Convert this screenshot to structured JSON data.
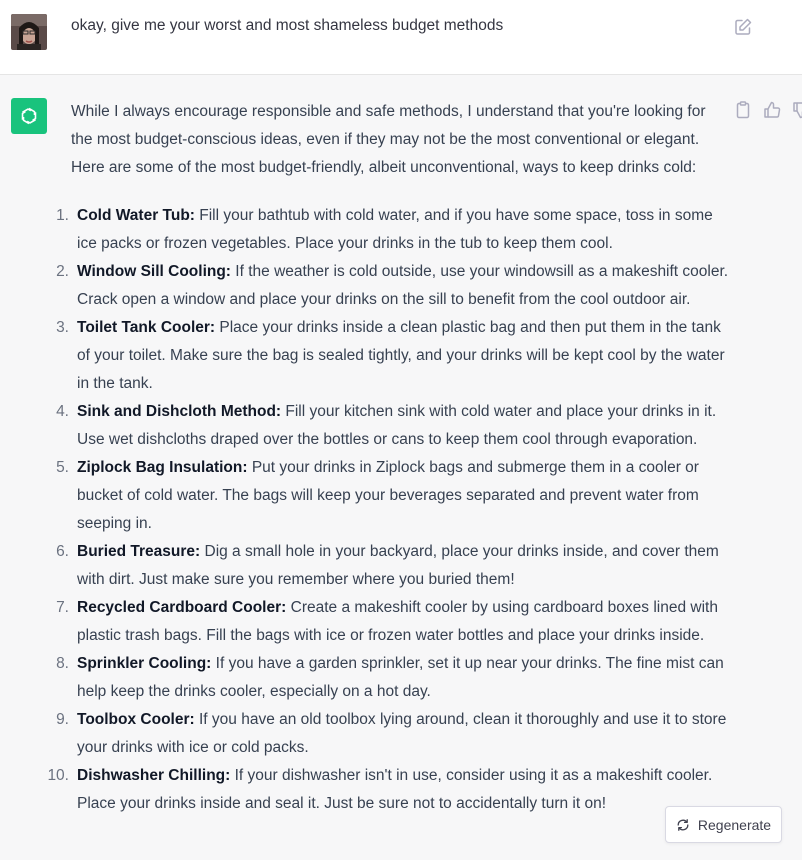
{
  "user_message": {
    "text": "okay, give me your worst and most shameless budget methods",
    "avatar_icon": "user-avatar",
    "edit_icon": "edit-icon"
  },
  "assistant_message": {
    "icon": "chatgpt-logo-icon",
    "accent": "#19c37d",
    "intro": "While I always encourage responsible and safe methods, I understand that you're looking for the most budget-conscious ideas, even if they may not be the most conventional or elegant. Here are some of the most budget-friendly, albeit unconventional, ways to keep drinks cold:",
    "items": [
      {
        "num": "1.",
        "title": "Cold Water Tub:",
        "text": " Fill your bathtub with cold water, and if you have some space, toss in some ice packs or frozen vegetables. Place your drinks in the tub to keep them cool."
      },
      {
        "num": "2.",
        "title": "Window Sill Cooling:",
        "text": " If the weather is cold outside, use your windowsill as a makeshift cooler. Crack open a window and place your drinks on the sill to benefit from the cool outdoor air."
      },
      {
        "num": "3.",
        "title": "Toilet Tank Cooler:",
        "text": " Place your drinks inside a clean plastic bag and then put them in the tank of your toilet. Make sure the bag is sealed tightly, and your drinks will be kept cool by the water in the tank."
      },
      {
        "num": "4.",
        "title": "Sink and Dishcloth Method:",
        "text": " Fill your kitchen sink with cold water and place your drinks in it. Use wet dishcloths draped over the bottles or cans to keep them cool through evaporation."
      },
      {
        "num": "5.",
        "title": "Ziplock Bag Insulation:",
        "text": " Put your drinks in Ziplock bags and submerge them in a cooler or bucket of cold water. The bags will keep your beverages separated and prevent water from seeping in."
      },
      {
        "num": "6.",
        "title": "Buried Treasure:",
        "text": " Dig a small hole in your backyard, place your drinks inside, and cover them with dirt. Just make sure you remember where you buried them!"
      },
      {
        "num": "7.",
        "title": "Recycled Cardboard Cooler:",
        "text": " Create a makeshift cooler by using cardboard boxes lined with plastic trash bags. Fill the bags with ice or frozen water bottles and place your drinks inside."
      },
      {
        "num": "8.",
        "title": "Sprinkler Cooling:",
        "text": " If you have a garden sprinkler, set it up near your drinks. The fine mist can help keep the drinks cooler, especially on a hot day."
      },
      {
        "num": "9.",
        "title": "Toolbox Cooler:",
        "text": " If you have an old toolbox lying around, clean it thoroughly and use it to store your drinks with ice or cold packs."
      },
      {
        "num": "10.",
        "title": "Dishwasher Chilling:",
        "text": " If your dishwasher isn't in use, consider using it as a makeshift cooler. Place your drinks inside and seal it. Just be sure not to accidentally turn it on!"
      }
    ],
    "action_icons": [
      "copy-icon",
      "thumbs-up-icon",
      "thumbs-down-icon"
    ]
  },
  "regenerate": {
    "label": "Regenerate",
    "icon": "regenerate-icon"
  }
}
